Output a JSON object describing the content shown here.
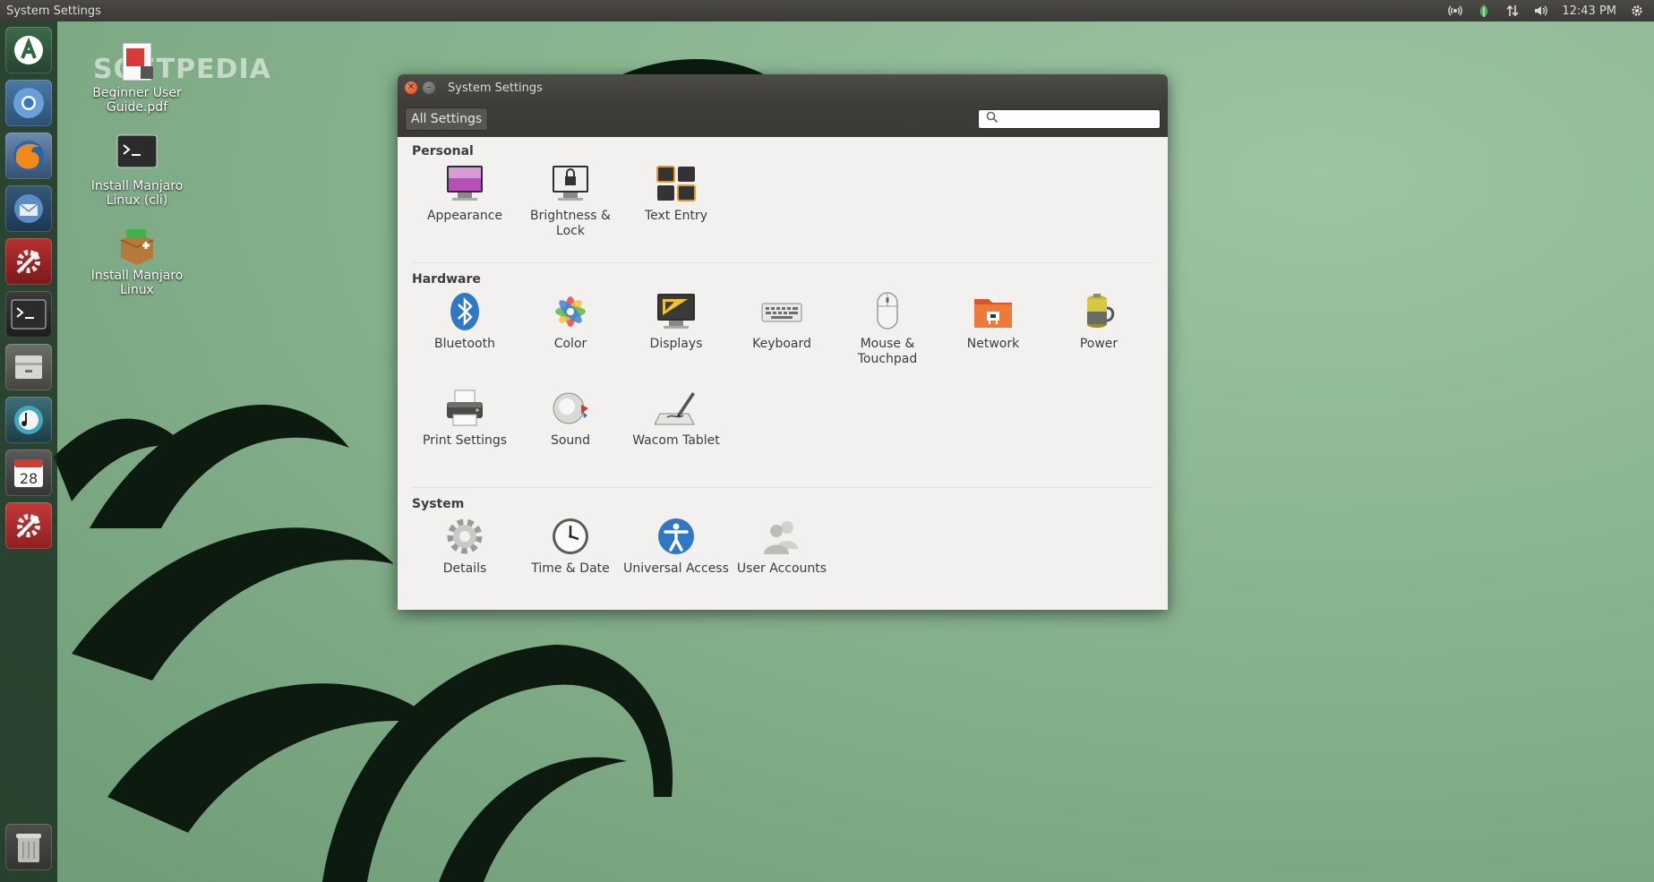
{
  "panel": {
    "app_title": "System Settings",
    "clock": "12:43 PM",
    "indicators": [
      "network-wireless-icon",
      "leaf-icon",
      "transfer-arrows-icon",
      "volume-icon",
      "gear-icon"
    ]
  },
  "launcher": {
    "items": [
      "manjaro-icon",
      "chromium-icon",
      "firefox-icon",
      "thunderbird-icon",
      "settings-tools-icon",
      "terminal-icon",
      "file-manager-icon",
      "music-player-icon",
      "calendar-icon",
      "system-settings-icon",
      "trash-icon"
    ],
    "calendar_day": "28"
  },
  "desktop_icons": [
    {
      "label": "Beginner User Guide.pdf"
    },
    {
      "label": "Install Manjaro Linux (cli)"
    },
    {
      "label": "Install Manjaro Linux"
    }
  ],
  "watermark": "SOFTPEDIA",
  "window": {
    "title": "System Settings",
    "all_settings_label": "All Settings",
    "search_value": "",
    "sections": [
      {
        "title": "Personal",
        "items": [
          {
            "label": "Appearance",
            "icon": "appearance-icon"
          },
          {
            "label": "Brightness & Lock",
            "icon": "brightness-lock-icon"
          },
          {
            "label": "Text Entry",
            "icon": "text-entry-icon"
          }
        ]
      },
      {
        "title": "Hardware",
        "items": [
          {
            "label": "Bluetooth",
            "icon": "bluetooth-icon"
          },
          {
            "label": "Color",
            "icon": "color-icon"
          },
          {
            "label": "Displays",
            "icon": "displays-icon"
          },
          {
            "label": "Keyboard",
            "icon": "keyboard-icon"
          },
          {
            "label": "Mouse & Touchpad",
            "icon": "mouse-icon"
          },
          {
            "label": "Network",
            "icon": "network-icon"
          },
          {
            "label": "Power",
            "icon": "power-icon"
          },
          {
            "label": "Print Settings",
            "icon": "printer-icon"
          },
          {
            "label": "Sound",
            "icon": "sound-icon"
          },
          {
            "label": "Wacom Tablet",
            "icon": "wacom-tablet-icon"
          }
        ]
      },
      {
        "title": "System",
        "items": [
          {
            "label": "Details",
            "icon": "details-gear-icon"
          },
          {
            "label": "Time & Date",
            "icon": "clock-icon"
          },
          {
            "label": "Universal Access",
            "icon": "universal-access-icon"
          },
          {
            "label": "User Accounts",
            "icon": "user-accounts-icon"
          }
        ]
      }
    ]
  },
  "colors": {
    "panel_bg": "#3b3a37",
    "close_button": "#e05a2b",
    "window_bg": "#f2f1f0",
    "wallpaper": "#8ab591"
  }
}
